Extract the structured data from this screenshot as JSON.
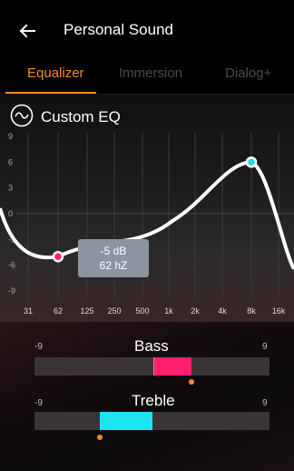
{
  "header": {
    "title": "Personal Sound"
  },
  "tabs": [
    {
      "label": "Equalizer",
      "active": true
    },
    {
      "label": "Immersion",
      "active": false
    },
    {
      "label": "Dialog+",
      "active": false
    }
  ],
  "eq": {
    "title": "Custom EQ",
    "y_ticks": [
      "9",
      "6",
      "3",
      "0",
      "-3",
      "-6",
      "-9"
    ],
    "x_ticks": [
      "31",
      "62",
      "125",
      "250",
      "500",
      "1k",
      "2k",
      "4k",
      "8k",
      "16k"
    ],
    "tooltip": {
      "gain": "-5 dB",
      "freq": "62 hZ"
    },
    "points": [
      {
        "freq": "62",
        "gain_db": -5,
        "color": "#ff1f6e"
      },
      {
        "freq": "8k",
        "gain_db": 6,
        "color": "#22d8e8"
      }
    ]
  },
  "bass": {
    "label": "Bass",
    "min": "-9",
    "max": "9",
    "level": 3,
    "color": "#ff1f6e"
  },
  "treble": {
    "label": "Treble",
    "min": "-9",
    "max": "9",
    "level": -4,
    "color": "#1ee6f0"
  },
  "colors": {
    "accent": "#f28a2c",
    "tab_inactive": "#4a4a4a"
  }
}
